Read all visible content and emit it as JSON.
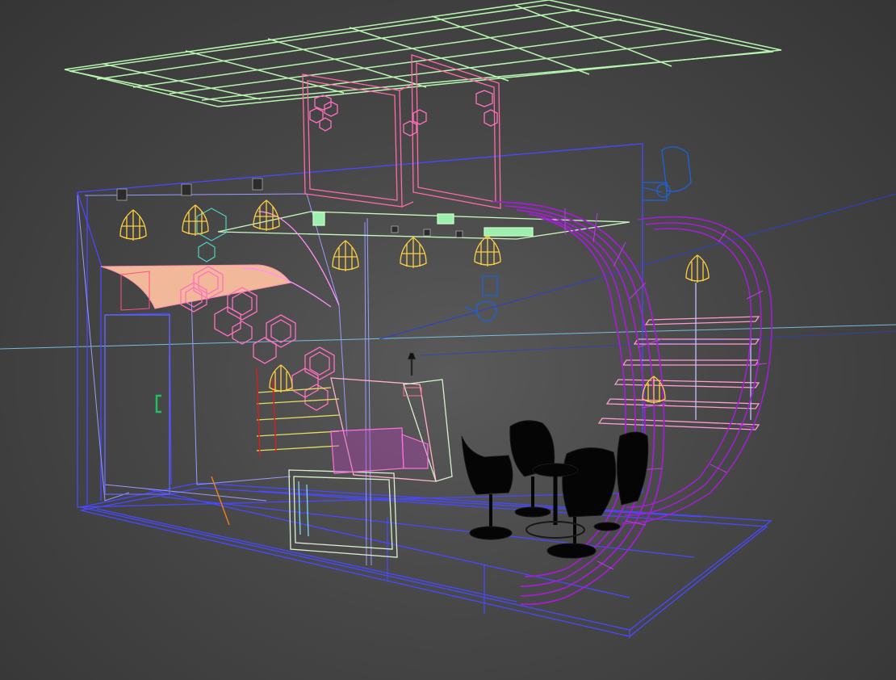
{
  "viewport": {
    "mode": "wireframe",
    "background_color": "#474747"
  },
  "colors": {
    "ceiling_grid": "#b8f5b0",
    "booth_frame": "#4848ff",
    "booth_frame_light": "#9a9aff",
    "arch": "#a020d0",
    "arch_light": "#c040e8",
    "hex_panels": "#ff70c0",
    "pendant_lamps": "#ffd040",
    "chairs": "#000000",
    "screens": "#ff6aa8",
    "wall_panel_fill": "#f2b89a",
    "shelves": "#e8e060",
    "shelf_stands": "#d02020",
    "counter": "#d8f0d0",
    "horizon_line": "#80d8ff",
    "camera_icon": "#2060d0",
    "door_handle": "#20c060"
  },
  "objects": {
    "ceiling_grid": "ceiling-grid",
    "booth_frame": "booth-frame",
    "arch_left": "arch-left",
    "arch_right": "arch-right",
    "hex_decor": "hex-decor",
    "pendant_lamps": "pendant-lamp",
    "lounge_chairs": "lounge-chair",
    "display_screens": "display-screen",
    "reception_counter": "reception-counter",
    "display_shelves": "display-shelf",
    "spotlights": "spotlight",
    "door": "door",
    "camera_icons": "camera-icon"
  }
}
